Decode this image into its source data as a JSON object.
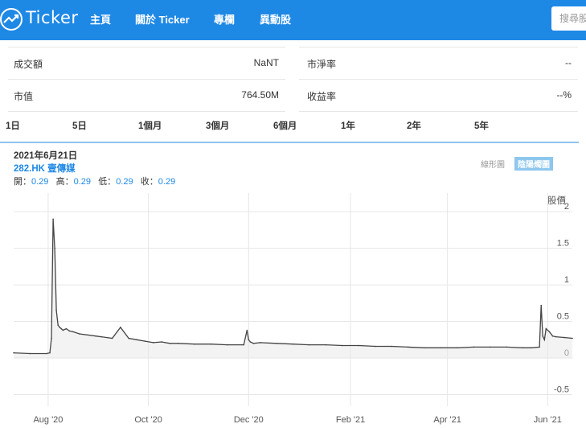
{
  "header": {
    "logo_text": "Ticker",
    "nav": [
      "主頁",
      "關於 Ticker",
      "專欄",
      "異動股"
    ],
    "search_placeholder": "搜尋股票"
  },
  "stats": [
    {
      "label": "成交額",
      "value": "NaNT"
    },
    {
      "label": "市淨率",
      "value": "--"
    },
    {
      "label": "市值",
      "value": "764.50M"
    },
    {
      "label": "收益率",
      "value": "--%"
    }
  ],
  "ranges": [
    "1日",
    "5日",
    "1個月",
    "3個月",
    "6個月",
    "1年",
    "2年",
    "5年"
  ],
  "active_range": "1年",
  "chart_header": {
    "date": "2021年6月21日",
    "symbol": "282.HK 壹傳媒",
    "open_label": "開：",
    "open": "0.29",
    "high_label": "高：",
    "high": "0.29",
    "low_label": "低：",
    "low": "0.29",
    "close_label": "收：",
    "close": "0.29",
    "toggle_line": "線形圖",
    "toggle_candle": "陰陽燭圖"
  },
  "colors": {
    "brand": "#1e88e5",
    "series": "#444444"
  },
  "chart_data": {
    "type": "line",
    "ylabel": "股價",
    "ylim": [
      -0.55,
      2.2
    ],
    "yticks": [
      2,
      1.5,
      1,
      0.5,
      0,
      -0.5
    ],
    "xtick_labels": [
      "Aug '20",
      "Oct '20",
      "Dec '20",
      "Feb '21",
      "Apr '21",
      "Jun '21"
    ],
    "xtick_days": [
      21,
      82,
      143,
      205,
      264,
      325
    ],
    "x_days": [
      0,
      10,
      20,
      22,
      23,
      24,
      25,
      26,
      27,
      28,
      29,
      30,
      32,
      34,
      36,
      40,
      50,
      60,
      65,
      70,
      75,
      80,
      85,
      90,
      95,
      100,
      110,
      120,
      130,
      140,
      142,
      143,
      144,
      146,
      150,
      160,
      170,
      180,
      190,
      200,
      210,
      220,
      230,
      240,
      250,
      260,
      270,
      280,
      290,
      300,
      310,
      315,
      320,
      321,
      322,
      323,
      324,
      326,
      328,
      330,
      335,
      340
    ],
    "values": [
      0.07,
      0.06,
      0.06,
      0.07,
      0.27,
      1.9,
      1.5,
      0.65,
      0.45,
      0.42,
      0.4,
      0.38,
      0.4,
      0.37,
      0.36,
      0.33,
      0.3,
      0.27,
      0.42,
      0.27,
      0.25,
      0.23,
      0.21,
      0.22,
      0.2,
      0.2,
      0.19,
      0.19,
      0.18,
      0.18,
      0.38,
      0.25,
      0.22,
      0.2,
      0.21,
      0.2,
      0.19,
      0.18,
      0.18,
      0.17,
      0.17,
      0.16,
      0.16,
      0.15,
      0.14,
      0.14,
      0.14,
      0.15,
      0.15,
      0.15,
      0.14,
      0.14,
      0.15,
      0.72,
      0.3,
      0.25,
      0.4,
      0.36,
      0.3,
      0.29,
      0.28,
      0.27
    ]
  }
}
